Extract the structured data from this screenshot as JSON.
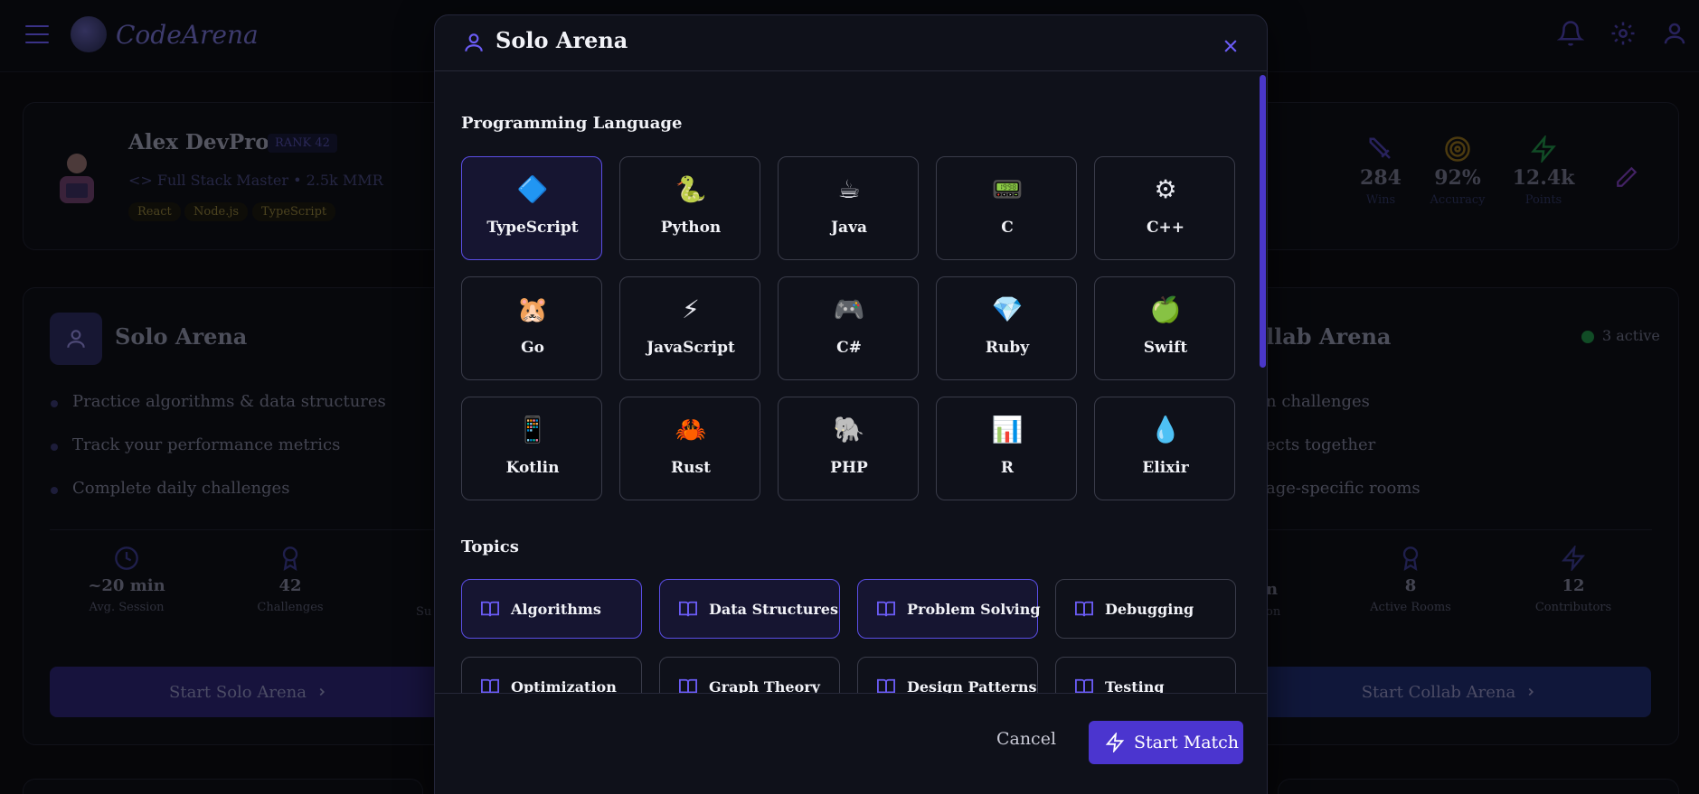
{
  "app": {
    "name": "CodeArena"
  },
  "profile": {
    "name": "Alex DevPro",
    "rank": "RANK 42",
    "title": "Full Stack Master",
    "separator": "•",
    "mmr": "2.5k MMR",
    "tags": [
      "React",
      "Node.js",
      "TypeScript"
    ],
    "stats": [
      {
        "value": "284",
        "label": "Wins",
        "icon": "sword-icon",
        "color": "#4a3fa8"
      },
      {
        "value": "92%",
        "label": "Accuracy",
        "icon": "target-icon",
        "color": "#8a6b1c"
      },
      {
        "value": "12.4k",
        "label": "Points",
        "icon": "bolt-icon",
        "color": "#1f8a45"
      }
    ]
  },
  "solo_card": {
    "title": "Solo Arena",
    "bullets": [
      "Practice algorithms & data structures",
      "Track your performance metrics",
      "Complete daily challenges"
    ],
    "stats": [
      {
        "value": "~20 min",
        "label": "Avg. Session"
      },
      {
        "value": "42",
        "label": "Challenges"
      }
    ],
    "partial_label": "Su",
    "button": "Start Solo Arena"
  },
  "collab_card": {
    "title_visible": "llab Arena",
    "active": "3 active",
    "bullets_visible": [
      "n challenges",
      "ects together",
      "age-specific rooms"
    ],
    "partial_value": "n",
    "partial_label": "on",
    "stats": [
      {
        "value": "8",
        "label": "Active Rooms"
      },
      {
        "value": "12",
        "label": "Contributors"
      }
    ],
    "button": "Start Collab Arena"
  },
  "modal": {
    "title": "Solo Arena",
    "language_section": "Programming Language",
    "topics_section": "Topics",
    "languages": [
      {
        "name": "TypeScript",
        "emoji": "🔷",
        "selected": true
      },
      {
        "name": "Python",
        "emoji": "🐍",
        "selected": false
      },
      {
        "name": "Java",
        "emoji": "☕",
        "selected": false
      },
      {
        "name": "C",
        "emoji": "📟",
        "selected": false
      },
      {
        "name": "C++",
        "emoji": "⚙",
        "selected": false
      },
      {
        "name": "Go",
        "emoji": "🐹",
        "selected": false
      },
      {
        "name": "JavaScript",
        "emoji": "⚡",
        "selected": false
      },
      {
        "name": "C#",
        "emoji": "🎮",
        "selected": false
      },
      {
        "name": "Ruby",
        "emoji": "💎",
        "selected": false
      },
      {
        "name": "Swift",
        "emoji": "🍏",
        "selected": false
      },
      {
        "name": "Kotlin",
        "emoji": "📱",
        "selected": false
      },
      {
        "name": "Rust",
        "emoji": "🦀",
        "selected": false
      },
      {
        "name": "PHP",
        "emoji": "🐘",
        "selected": false
      },
      {
        "name": "R",
        "emoji": "📊",
        "selected": false
      },
      {
        "name": "Elixir",
        "emoji": "💧",
        "selected": false
      }
    ],
    "topics": [
      {
        "name": "Algorithms",
        "selected": true
      },
      {
        "name": "Data Structures",
        "selected": true
      },
      {
        "name": "Problem Solving",
        "selected": true
      },
      {
        "name": "Debugging",
        "selected": false
      },
      {
        "name": "Optimization",
        "selected": false
      },
      {
        "name": "Graph Theory",
        "selected": false
      },
      {
        "name": "Design Patterns",
        "selected": false
      },
      {
        "name": "Testing",
        "selected": false
      }
    ],
    "cancel": "Cancel",
    "start": "Start Match"
  },
  "colors": {
    "accent": "#4b35cf",
    "selected_border": "#5b4ee6",
    "background": "#0b0c12"
  }
}
